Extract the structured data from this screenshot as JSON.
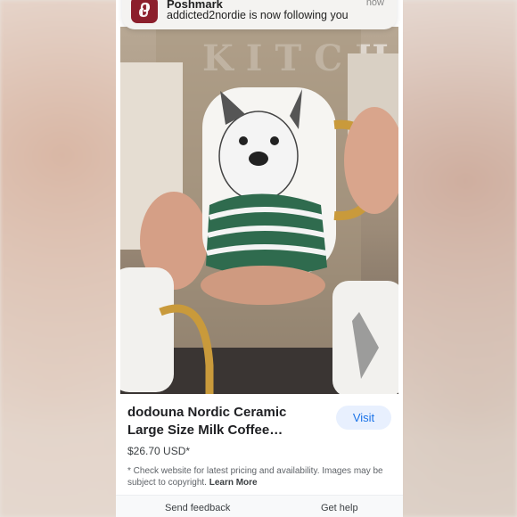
{
  "notification": {
    "app_name": "Poshmark",
    "time": "now",
    "message": "addicted2nordie is now following you",
    "icon": "poshmark-logo-icon"
  },
  "product": {
    "image_bg_text": "KITCHEN",
    "title": "dodouna Nordic Ceramic Large Size Milk Coffee Breakfast Mugs...",
    "visit_label": "Visit",
    "price": "$26.70 USD*",
    "disclaimer": "* Check website for latest pricing and availability. Images may be subject to copyright.",
    "learn_more_label": "Learn More"
  },
  "footer": {
    "send_feedback_label": "Send feedback",
    "get_help_label": "Get help"
  },
  "colors": {
    "accent_blue": "#1a73e8",
    "visit_bg": "#e8f0fe",
    "poshmark_red": "#8c1f2c"
  }
}
